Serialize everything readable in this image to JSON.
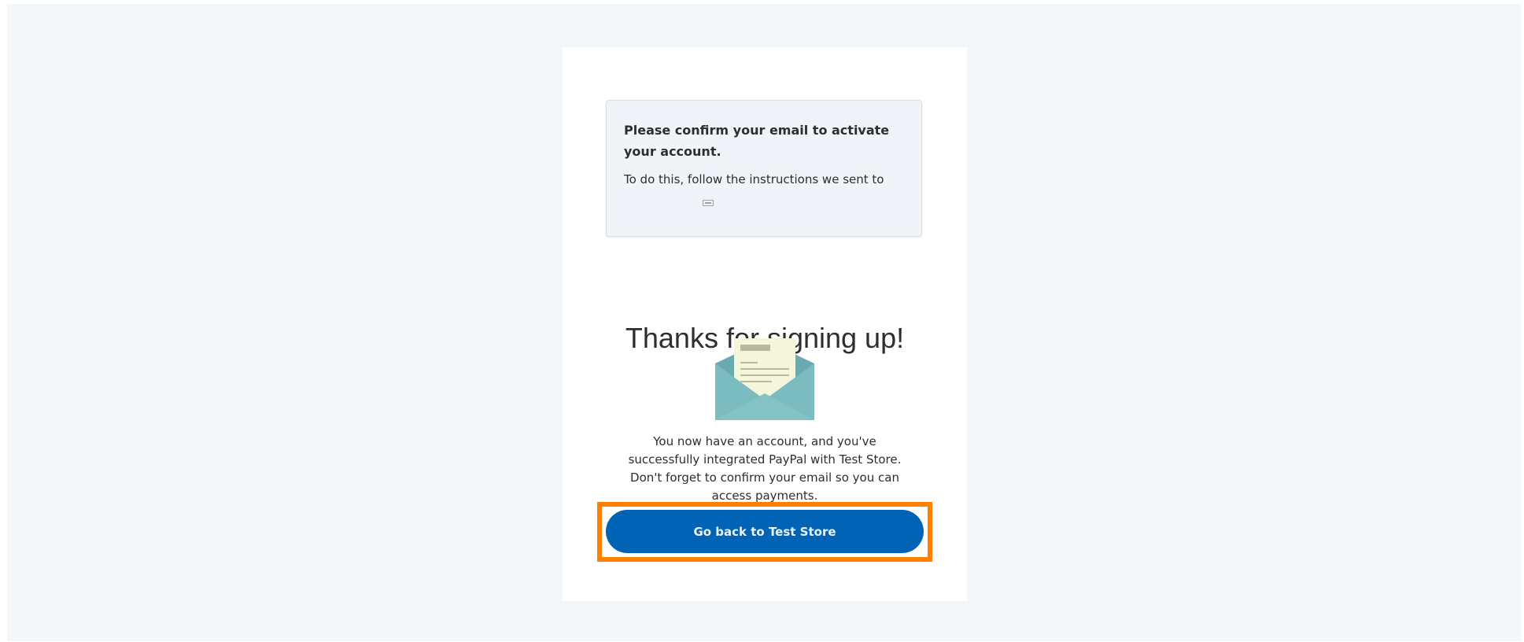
{
  "notice": {
    "title": "Please confirm your email to activate your account.",
    "body": "To do this, follow the instructions we sent to"
  },
  "headline": "Thanks for signing up!",
  "illustration": {
    "icon": "open-envelope-icon",
    "colors": {
      "envelope": "#76b6bc",
      "envelope_dark": "#5e9ea6",
      "letter": "#f5f5dc",
      "letter_lines": "#b9b99a"
    }
  },
  "message": "You now have an account, and you've successfully integrated PayPal with Test Store. Don't forget to confirm your email so you can access payments.",
  "cta": {
    "label": "Go back to Test Store"
  },
  "colors": {
    "page_background": "#f4f7f9",
    "button": "#0063b5",
    "highlight": "#ff8000"
  }
}
